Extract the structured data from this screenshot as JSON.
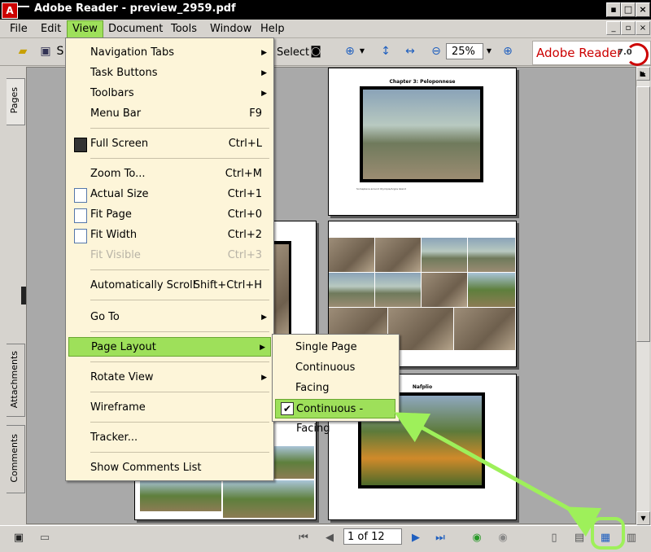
{
  "window": {
    "title": "Adobe Reader - preview_2959.pdf",
    "minimize_glyph": "▪",
    "maximize_glyph": "□",
    "close_glyph": "×"
  },
  "menubar": {
    "items": [
      "File",
      "Edit",
      "View",
      "Document",
      "Tools",
      "Window",
      "Help"
    ],
    "active": "View"
  },
  "toolbar": {
    "save_label": "S",
    "select_label": "Select",
    "zoom_value": "25%"
  },
  "brand": {
    "name": "Adobe Reader",
    "version": "7.0"
  },
  "left_nav": {
    "tabs": [
      "Pages",
      "Attachments",
      "Comments"
    ]
  },
  "view_menu": {
    "items": [
      {
        "label": "Navigation Tabs",
        "shortcut": "",
        "submenu": true
      },
      {
        "label": "Task Buttons",
        "shortcut": "",
        "submenu": true
      },
      {
        "label": "Toolbars",
        "shortcut": "",
        "submenu": true
      },
      {
        "label": "Menu Bar",
        "shortcut": "F9",
        "submenu": false
      },
      {
        "label": "Full Screen",
        "shortcut": "Ctrl+L",
        "submenu": false
      },
      {
        "label": "Zoom To...",
        "shortcut": "Ctrl+M",
        "submenu": false
      },
      {
        "label": "Actual Size",
        "shortcut": "Ctrl+1",
        "submenu": false
      },
      {
        "label": "Fit Page",
        "shortcut": "Ctrl+0",
        "submenu": false
      },
      {
        "label": "Fit Width",
        "shortcut": "Ctrl+2",
        "submenu": false
      },
      {
        "label": "Fit Visible",
        "shortcut": "Ctrl+3",
        "submenu": false,
        "disabled": true
      },
      {
        "label": "Automatically Scroll",
        "shortcut": "Shift+Ctrl+H",
        "submenu": false
      },
      {
        "label": "Go To",
        "shortcut": "",
        "submenu": true
      },
      {
        "label": "Page Layout",
        "shortcut": "",
        "submenu": true,
        "highlighted": true
      },
      {
        "label": "Rotate View",
        "shortcut": "",
        "submenu": true
      },
      {
        "label": "Wireframe",
        "shortcut": "",
        "submenu": false
      },
      {
        "label": "Tracker...",
        "shortcut": "",
        "submenu": false
      },
      {
        "label": "Show Comments List",
        "shortcut": "",
        "submenu": false
      }
    ]
  },
  "page_layout_submenu": {
    "items": [
      "Single Page",
      "Continuous",
      "Facing",
      "Continuous - Facing"
    ],
    "checked": "Continuous - Facing"
  },
  "document": {
    "page1_heading": "Chapter 3: Peloponnese",
    "page1_caption": "Someplace around Olympia/Argos Island",
    "page3_heading": "Nafplio"
  },
  "statusbar": {
    "page_indicator": "1 of 12"
  },
  "colors": {
    "highlight": "#9ee05a",
    "menu_bg": "#fdf5d9",
    "annotation": "#9ef05a",
    "brand_red": "#cc0000"
  }
}
